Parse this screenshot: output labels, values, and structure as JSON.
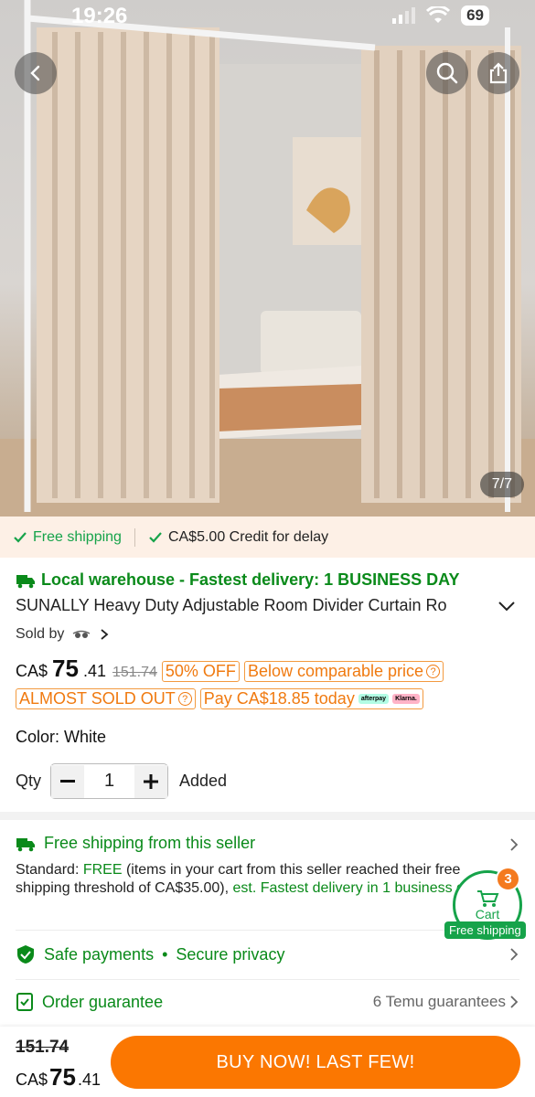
{
  "status_bar": {
    "time": "19:26",
    "battery": "69"
  },
  "hero": {
    "image_counter": "7/7"
  },
  "strip": {
    "free_shipping": "Free shipping",
    "credit": "CA$5.00 Credit for delay"
  },
  "product": {
    "warehouse": "Local warehouse - Fastest delivery: 1 BUSINESS DAY",
    "title": "SUNALLY Heavy Duty Adjustable Room Divider Curtain Ro",
    "sold_by": "Sold by",
    "currency": "CA$",
    "price_main": "75",
    "price_cents": ".41",
    "original_price": "151.74",
    "discount_tag": "50% OFF",
    "comparable_tag": "Below comparable price",
    "almost_sold_out": "ALMOST SOLD OUT",
    "pay_today": "Pay CA$18.85 today",
    "afterpay": "afterpay",
    "klarna": "Klarna.",
    "color_label": "Color: White",
    "qty_label": "Qty",
    "qty_value": "1",
    "added": "Added"
  },
  "shipping": {
    "title": "Free shipping from this seller",
    "standard": "Standard: ",
    "free": "FREE",
    "text": " (items in your cart from this seller reached their free shipping threshold of CA$35.00), ",
    "est": "est. Fastest delivery in 1 business day"
  },
  "cart": {
    "label": "Cart",
    "count": "3",
    "free_shipping": "Free shipping"
  },
  "safe_payments": {
    "label": "Safe payments",
    "secure": "Secure privacy"
  },
  "guarantee": {
    "label": "Order guarantee",
    "right": "6 Temu guarantees"
  },
  "bottom": {
    "old_price": "151.74",
    "currency": "CA$",
    "price_main": "75",
    "price_cents": ".41",
    "buy_label": "BUY NOW! LAST FEW!"
  },
  "colors": {
    "green": "#0a8a1a",
    "orange": "#fb7701",
    "tag_orange": "#f07a10"
  }
}
